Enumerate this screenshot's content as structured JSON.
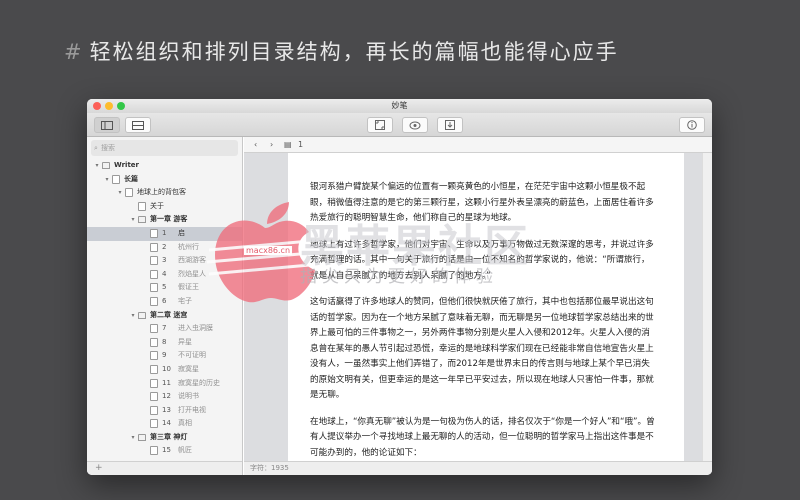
{
  "headline": {
    "hash": "#",
    "text": "轻松组织和排列目录结构，再长的篇幅也能得心应手"
  },
  "window": {
    "title": "妙笔"
  },
  "toolbar": {
    "icons": [
      "sidebar-icon",
      "panel-icon",
      "fullscreen-icon",
      "preview-icon",
      "export-icon",
      "info-icon"
    ]
  },
  "sidebar": {
    "search_placeholder": "搜索",
    "tree": [
      {
        "type": "folder",
        "label": "Writer",
        "level": 0,
        "expanded": true
      },
      {
        "type": "book",
        "label": "长篇",
        "level": 1,
        "expanded": true
      },
      {
        "type": "book",
        "label": "地球上的背包客",
        "level": 2,
        "expanded": true
      },
      {
        "type": "doc",
        "label": "关于",
        "level": 3
      },
      {
        "type": "folder",
        "label": "第一章  游客",
        "level": 3,
        "expanded": true
      },
      {
        "type": "doc",
        "num": "1",
        "label": "启",
        "level": 4,
        "selected": true
      },
      {
        "type": "doc",
        "num": "2",
        "label": "杭州行",
        "level": 4
      },
      {
        "type": "doc",
        "num": "3",
        "label": "西湖游客",
        "level": 4
      },
      {
        "type": "doc",
        "num": "4",
        "label": "烈焰星人",
        "level": 4
      },
      {
        "type": "doc",
        "num": "5",
        "label": "假证王",
        "level": 4
      },
      {
        "type": "doc",
        "num": "6",
        "label": "宅子",
        "level": 4
      },
      {
        "type": "folder",
        "label": "第二章  迷宫",
        "level": 3,
        "expanded": true
      },
      {
        "type": "doc",
        "num": "7",
        "label": "进入虫洞膜",
        "level": 4
      },
      {
        "type": "doc",
        "num": "8",
        "label": "异星",
        "level": 4
      },
      {
        "type": "doc",
        "num": "9",
        "label": "不可证明",
        "level": 4
      },
      {
        "type": "doc",
        "num": "10",
        "label": "寂寞星",
        "level": 4
      },
      {
        "type": "doc",
        "num": "11",
        "label": "寂寞星的历史",
        "level": 4
      },
      {
        "type": "doc",
        "num": "12",
        "label": "说明书",
        "level": 4
      },
      {
        "type": "doc",
        "num": "13",
        "label": "打开电视",
        "level": 4
      },
      {
        "type": "doc",
        "num": "14",
        "label": "真相",
        "level": 4
      },
      {
        "type": "folder",
        "label": "第三章  神灯",
        "level": 3,
        "expanded": true
      },
      {
        "type": "doc",
        "num": "15",
        "label": "帆匠",
        "level": 4
      }
    ],
    "footer_add": "+"
  },
  "editor": {
    "nav": {
      "back": "‹",
      "forward": "›",
      "page_num": "1",
      "up": "⌃",
      "down": "⌄"
    },
    "paragraphs": [
      "银河系猎户臂旋某个偏远的位置有一颗亮黄色的小恒星，在茫茫宇宙中这颗小恒星极不起眼，稍微值得注意的是它的第三颗行星，这颗小行星外表呈漂亮的蔚蓝色，上面居住着许多热爱旅行的聪明智慧生命，他们称自己的星球为地球。",
      "地球上有过许多哲学家，他们对宇宙、生命以及万事万物做过无数深邃的思考，并说过许多充满哲理的话。其中一句关于旅行的话是由一位不知名的哲学家说的，他说：“所谓旅行，就是从自己呆腻了的地方去别人呆腻了的地方。”",
      "这句话赢得了许多地球人的赞同，但他们很快就厌倦了旅行，其中也包括那位最早说出这句话的哲学家。因为在一个地方呆腻了意味着无聊，而无聊是另一位地球哲学家总结出来的世界上最可怕的三件事物之一，另外两件事物分别是火星人入侵和2012年。火星人入侵的消息曾在某年的愚人节引起过恐慌，幸运的是地球科学家们现在已经能非常自信地宣告火星上没有人，一虽然事实上他们弄错了，而2012年是世界末日的传言则与地球上某个早已消失的原始文明有关，但更幸运的是这一年早已平安过去，所以现在地球人只害怕一件事，那就是无聊。",
      "在地球上，“你真无聊”被认为是一句极为伤人的话，排名仅次于“你是一个好人”和“哦”。曾有人提议举办一个寻找地球上最无聊的人的活动，但一位聪明的哲学家马上指出这件事是不可能办到的，他的论证如下："
    ],
    "status": "字符：1935"
  },
  "watermark": {
    "title": "黑苹果社区",
    "subtitle": "指尖只为更好的体验",
    "domain": "macx86.cn"
  }
}
